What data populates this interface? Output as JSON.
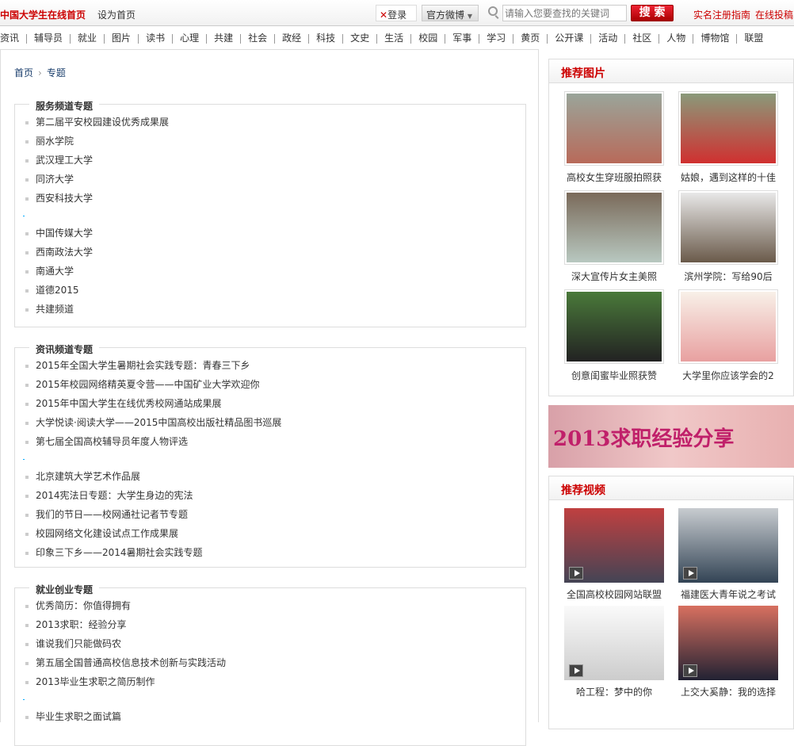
{
  "header": {
    "site_title": "中国大学生在线首页",
    "set_home": "设为首页",
    "login": "登录",
    "weibo": "官方微博",
    "search_placeholder": "请输入您要查找的关键词",
    "search_button": "搜 索",
    "links": [
      "实名注册指南",
      "在线投稿"
    ]
  },
  "nav": [
    "资讯",
    "辅导员",
    "就业",
    "图片",
    "读书",
    "心理",
    "共建",
    "社会",
    "政经",
    "科技",
    "文史",
    "生活",
    "校园",
    "军事",
    "学习",
    "黄页",
    "公开课",
    "活动",
    "社区",
    "人物",
    "博物馆",
    "联盟"
  ],
  "breadcrumb": {
    "home": "首页",
    "current": "专题"
  },
  "sections": [
    {
      "title": "服务频道专题",
      "items": [
        "第二届平安校园建设优秀成果展",
        "丽水学院",
        "武汉理工大学",
        "同济大学",
        "西安科技大学",
        "",
        "中国传媒大学",
        "西南政法大学",
        "南通大学",
        "道德2015",
        "共建频道"
      ]
    },
    {
      "title": "资讯频道专题",
      "items": [
        "2015年全国大学生暑期社会实践专题：青春三下乡",
        "2015年校园网络精英夏令营——中国矿业大学欢迎你",
        "2015年中国大学生在线优秀校网通站成果展",
        "大学悦读·阅读大学——2015中国高校出版社精品图书巡展",
        "第七届全国高校辅导员年度人物评选",
        "",
        "北京建筑大学艺术作品展",
        "2014宪法日专题：大学生身边的宪法",
        "我们的节日——校网通社记者节专题",
        "校园网络文化建设试点工作成果展",
        "印象三下乡——2014暑期社会实践专题"
      ]
    },
    {
      "title": "就业创业专题",
      "items": [
        "优秀简历：你值得拥有",
        "2013求职：经验分享",
        "谁说我们只能做码农",
        "第五届全国普通高校信息技术创新与实践活动",
        "2013毕业生求职之简历制作",
        "",
        "毕业生求职之面试篇"
      ]
    }
  ],
  "photos": {
    "title": "推荐图片",
    "items": [
      {
        "caption": "高校女生穿班服拍照获",
        "colors": [
          "#9aa59a",
          "#b86a5a"
        ]
      },
      {
        "caption": "姑娘，遇到这样的十佳",
        "colors": [
          "#8a9a7a",
          "#d03030"
        ]
      },
      {
        "caption": "深大宣传片女主美照",
        "colors": [
          "#7a6a5a",
          "#b8c8c0"
        ]
      },
      {
        "caption": "滨州学院：写给90后",
        "colors": [
          "#e8e8e8",
          "#6a5a4a"
        ]
      },
      {
        "caption": "创意闺蜜毕业照获赞",
        "colors": [
          "#4a7a3a",
          "#222"
        ]
      },
      {
        "caption": "大学里你应该学会的2",
        "colors": [
          "#f8f0e8",
          "#e8a0a0"
        ]
      }
    ]
  },
  "banner": {
    "text": "2013求职经验分享"
  },
  "videos": {
    "title": "推荐视频",
    "items": [
      {
        "caption": "全国高校校园网站联盟",
        "colors": [
          "#c04040",
          "#445"
        ]
      },
      {
        "caption": "福建医大青年说之考试",
        "colors": [
          "#c8ccd0",
          "#345"
        ]
      },
      {
        "caption": "哈工程：梦中的你",
        "colors": [
          "#fafafa",
          "#ccc"
        ]
      },
      {
        "caption": "上交大奚静：我的选择",
        "colors": [
          "#d87060",
          "#223"
        ]
      }
    ]
  }
}
